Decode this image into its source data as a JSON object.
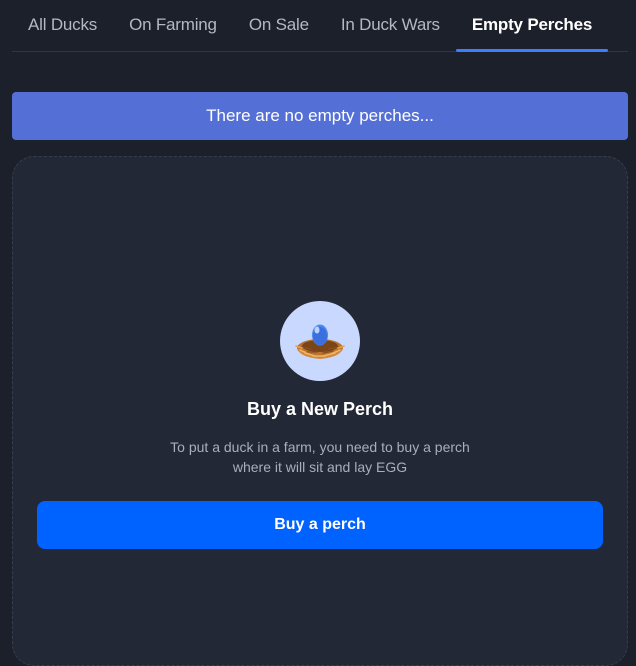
{
  "tabs": [
    {
      "label": "All Ducks",
      "active": false
    },
    {
      "label": "On Farming",
      "active": false
    },
    {
      "label": "On Sale",
      "active": false
    },
    {
      "label": "In Duck Wars",
      "active": false
    },
    {
      "label": "Empty Perches",
      "active": true
    }
  ],
  "banner": {
    "text": "There are no empty perches..."
  },
  "card": {
    "icon": "egg-nest-icon",
    "title": "Buy a New Perch",
    "description": "To put a duck in a farm, you need to buy a perch where it will sit and lay EGG",
    "button_label": "Buy a perch"
  },
  "colors": {
    "background": "#1b202b",
    "card": "#222836",
    "banner": "#5470d6",
    "accent": "#0062ff",
    "tab_underline": "#3d7dff"
  }
}
